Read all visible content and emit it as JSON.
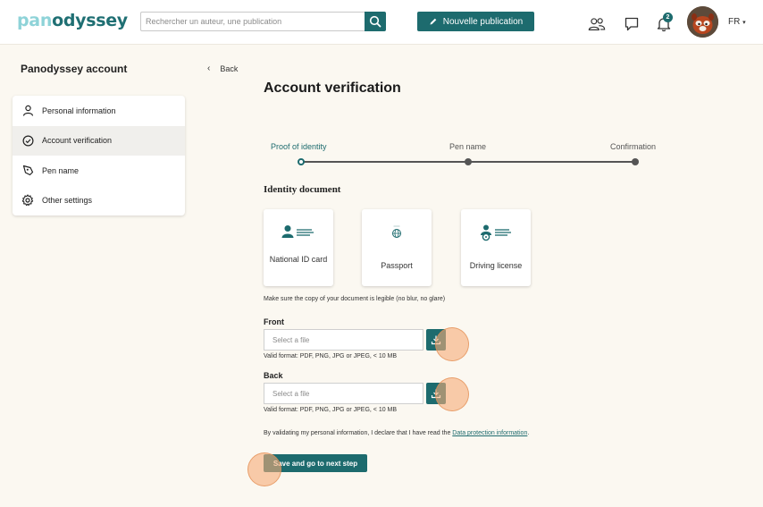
{
  "header": {
    "logo_part1": "pan",
    "logo_part2": "odyssey",
    "search_placeholder": "Rechercher un auteur, une publication",
    "new_publication_label": "Nouvelle publication",
    "notification_count": "2",
    "language": "FR"
  },
  "sidebar": {
    "title": "Panodyssey account",
    "items": [
      {
        "label": "Personal information",
        "icon": "person-icon"
      },
      {
        "label": "Account verification",
        "icon": "check-circle-icon",
        "active": true
      },
      {
        "label": "Pen name",
        "icon": "pen-nib-icon"
      },
      {
        "label": "Other settings",
        "icon": "gear-icon"
      }
    ]
  },
  "main": {
    "back_label": "Back",
    "title": "Account verification",
    "steps": [
      {
        "label": "Proof of identity",
        "active": true
      },
      {
        "label": "Pen name"
      },
      {
        "label": "Confirmation"
      }
    ],
    "section_title": "Identity document",
    "documents": [
      {
        "label": "National ID card",
        "icon": "id-card-icon"
      },
      {
        "label": "Passport",
        "icon": "passport-icon"
      },
      {
        "label": "Driving license",
        "icon": "driving-license-icon"
      }
    ],
    "hint": "Make sure the copy of your document is legible (no blur, no glare)",
    "front": {
      "label": "Front",
      "placeholder": "Select a file",
      "valid_format": "Valid format: PDF, PNG, JPG or JPEG, < 10 MB"
    },
    "back": {
      "label": "Back",
      "placeholder": "Select a file",
      "valid_format": "Valid format: PDF, PNG, JPG or JPEG, < 10 MB"
    },
    "declaration_text": "By validating my personal information, I declare that I have read the ",
    "declaration_link": "Data protection information",
    "declaration_end": ".",
    "submit_label": "Save and go to next step"
  },
  "colors": {
    "brand": "#1d6b6e",
    "logo_light": "#8ed3d8",
    "background": "#fbf8f1"
  }
}
